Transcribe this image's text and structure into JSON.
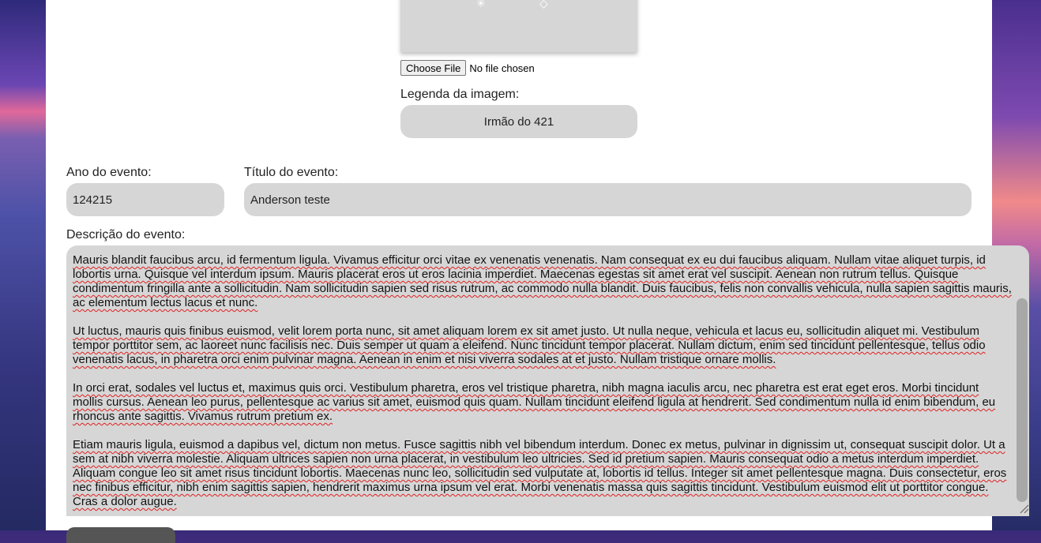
{
  "upload": {
    "choose_file_label": "Choose File",
    "file_status": "No file chosen"
  },
  "caption": {
    "label": "Legenda da imagem:",
    "value": "Irmão do 421"
  },
  "event_year": {
    "label": "Ano do evento:",
    "value": "124215"
  },
  "event_title": {
    "label": "Título do evento:",
    "value": "Anderson teste"
  },
  "event_description": {
    "label": "Descrição do evento:",
    "paragraphs": [
      "Mauris blandit faucibus arcu, id fermentum ligula. Vivamus efficitur orci vitae ex venenatis venenatis. Nam consequat ex eu dui faucibus aliquam. Nullam vitae aliquet turpis, id lobortis urna. Quisque vel interdum ipsum. Mauris placerat eros ut eros lacinia imperdiet. Maecenas egestas sit amet erat vel suscipit. Aenean non rutrum tellus. Quisque condimentum fringilla ante a sollicitudin. Nam sollicitudin sapien sed risus rutrum, ac commodo nulla blandit. Duis faucibus, felis non convallis vehicula, nulla sapien sagittis mauris, ac elementum lectus lacus et nunc.",
      "Ut luctus, mauris quis finibus euismod, velit lorem porta nunc, sit amet aliquam lorem ex sit amet justo. Ut nulla neque, vehicula et lacus eu, sollicitudin aliquet mi. Vestibulum tempor porttitor sem, ac laoreet nunc facilisis nec. Duis semper ut quam a eleifend. Nunc tincidunt tempor placerat. Nullam dictum, enim sed tincidunt pellentesque, tellus odio venenatis lacus, in pharetra orci enim pulvinar magna. Aenean in enim et nisi viverra sodales at et justo. Nullam tristique ornare mollis.",
      "In orci erat, sodales vel luctus et, maximus quis orci. Vestibulum pharetra, eros vel tristique pharetra, nibh magna iaculis arcu, nec pharetra est erat eget eros. Morbi tincidunt mollis cursus. Aenean leo purus, pellentesque ac varius sit amet, euismod quis quam. Nullam tincidunt eleifend ligula at hendrerit. Sed condimentum nulla id enim bibendum, eu rhoncus ante sagittis. Vivamus rutrum pretium ex.",
      "Etiam mauris ligula, euismod a dapibus vel, dictum non metus. Fusce sagittis nibh vel bibendum interdum. Donec ex metus, pulvinar in dignissim ut, consequat suscipit dolor. Ut a sem at nibh viverra molestie. Aliquam ultrices sapien non urna placerat, in vestibulum leo ultricies. Sed id pretium sapien. Mauris consequat odio a metus interdum imperdiet. Aliquam congue leo sit amet risus tincidunt lobortis. Maecenas nunc leo, sollicitudin sed vulputate at, lobortis id tellus. Integer sit amet pellentesque magna. Duis consectetur, eros nec finibus efficitur, nibh enim sagittis sapien, hendrerit maximus urna ipsum vel erat. Morbi venenatis massa quis sagittis tincidunt. Vestibulum euismod elit ut porttitor congue. Cras a dolor augue."
    ]
  },
  "colors": {
    "field_bg": "#d6d6d6",
    "panel_bg": "#ffffff",
    "spellcheck_underline": "#e02020"
  }
}
